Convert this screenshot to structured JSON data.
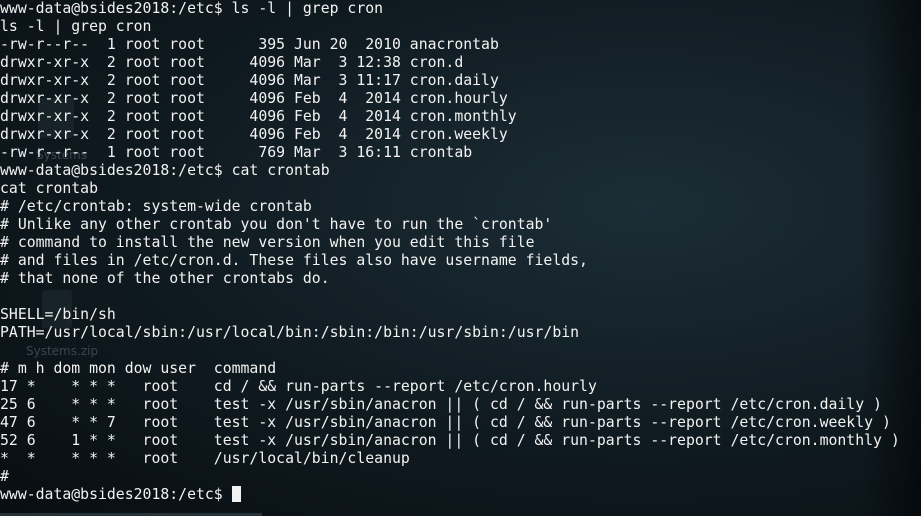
{
  "desktop": {
    "ghost_labels": [
      "Systems",
      "Systems.zip"
    ]
  },
  "terminal": {
    "lines": [
      "www-data@bsides2018:/etc$ ls -l | grep cron",
      "ls -l | grep cron",
      "-rw-r--r--  1 root root      395 Jun 20  2010 anacrontab",
      "drwxr-xr-x  2 root root     4096 Mar  3 12:38 cron.d",
      "drwxr-xr-x  2 root root     4096 Mar  3 11:17 cron.daily",
      "drwxr-xr-x  2 root root     4096 Feb  4  2014 cron.hourly",
      "drwxr-xr-x  2 root root     4096 Feb  4  2014 cron.monthly",
      "drwxr-xr-x  2 root root     4096 Feb  4  2014 cron.weekly",
      "-rw-r--r--  1 root root      769 Mar  3 16:11 crontab",
      "www-data@bsides2018:/etc$ cat crontab",
      "cat crontab",
      "# /etc/crontab: system-wide crontab",
      "# Unlike any other crontab you don't have to run the `crontab'",
      "# command to install the new version when you edit this file",
      "# and files in /etc/cron.d. These files also have username fields,",
      "# that none of the other crontabs do.",
      "",
      "SHELL=/bin/sh",
      "PATH=/usr/local/sbin:/usr/local/bin:/sbin:/bin:/usr/sbin:/usr/bin",
      "",
      "# m h dom mon dow user  command",
      "17 *    * * *   root    cd / && run-parts --report /etc/cron.hourly",
      "25 6    * * *   root    test -x /usr/sbin/anacron || ( cd / && run-parts --report /etc/cron.daily )",
      "47 6    * * 7   root    test -x /usr/sbin/anacron || ( cd / && run-parts --report /etc/cron.weekly )",
      "52 6    1 * *   root    test -x /usr/sbin/anacron || ( cd / && run-parts --report /etc/cron.monthly )",
      "*  *    * * *   root    /usr/local/bin/cleanup",
      "#"
    ],
    "prompt": "www-data@bsides2018:/etc$ "
  },
  "colors": {
    "text": "#f2f2f2",
    "background": "#0f1a20"
  }
}
